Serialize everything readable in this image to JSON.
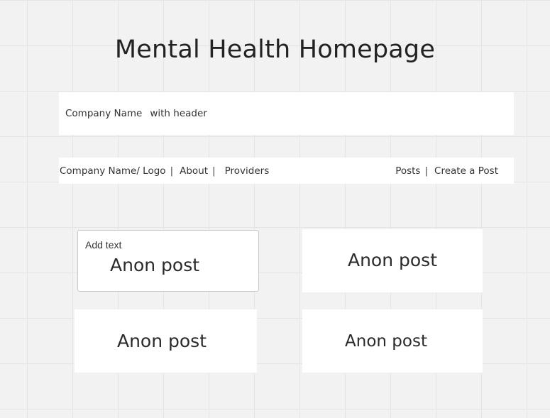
{
  "page": {
    "title": "Mental Health Homepage"
  },
  "header": {
    "company_name": "Company Name",
    "with_header": "with header"
  },
  "nav": {
    "logo_label": "Company Name/ Logo",
    "about_label": "About",
    "providers_label": "Providers",
    "posts_label": "Posts",
    "create_post_label": "Create a Post",
    "separator": "|"
  },
  "posts": [
    {
      "add_text_label": "Add text",
      "label": "Anon post"
    },
    {
      "label": "Anon post"
    },
    {
      "label": "Anon post"
    },
    {
      "label": "Anon post"
    }
  ],
  "colors": {
    "canvas_background": "#f2f2f2",
    "grid_line": "#e4e4e4",
    "panel_background": "#ffffff",
    "text": "#2a2a2a",
    "selected_border": "#c8c8c8"
  }
}
